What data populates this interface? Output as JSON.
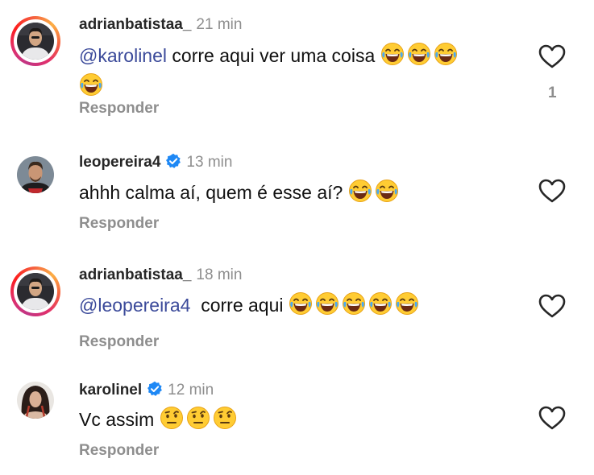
{
  "comments": [
    {
      "username": "adrianbatistaa_",
      "time": "21 min",
      "mention": "@karolinel",
      "text": " corre aqui ver uma coisa ",
      "emoji": "laughing-tears-icon",
      "emoji_count": 4,
      "reply_label": "Responder",
      "like_count": "1",
      "verified": false,
      "story_ring": true
    },
    {
      "username": "leopereira4",
      "time": "13 min",
      "mention": "",
      "text": "ahhh calma aí, quem é esse aí? ",
      "emoji": "laughing-tears-icon",
      "emoji_count": 2,
      "reply_label": "Responder",
      "verified": true,
      "story_ring": false
    },
    {
      "username": "adrianbatistaa_",
      "time": "18 min",
      "mention": "@leopereira4",
      "text": "  corre aqui ",
      "emoji": "laughing-tears-icon",
      "emoji_count": 5,
      "reply_label": "Responder",
      "verified": false,
      "story_ring": true
    },
    {
      "username": "karolinel",
      "time": "12 min",
      "mention": "",
      "text": "Vc assim ",
      "emoji": "raised-eyebrow-icon",
      "emoji_count": 3,
      "reply_label": "Responder",
      "verified": true,
      "story_ring": false
    }
  ],
  "colors": {
    "mention": "#3b4a9a",
    "verified": "#1e88f5",
    "muted": "#8e8e8e"
  }
}
